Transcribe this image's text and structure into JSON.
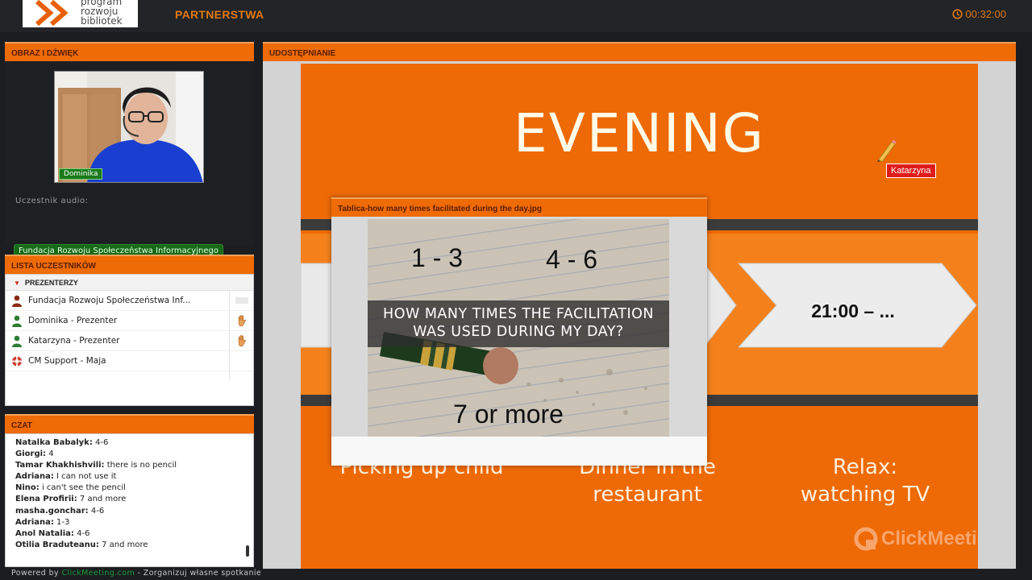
{
  "topbar": {
    "logo_lines": [
      "program",
      "rozwoju",
      "bibliotek"
    ],
    "meeting_title": "PARTNERSTWA",
    "timer": "00:32:00"
  },
  "video_panel": {
    "header": "OBRAZ I DŹWIĘK",
    "presenter_name": "Dominika",
    "audio_label": "Uczestnik audio:",
    "org_name": "Fundacja Rozwoju Społeczeństwa Informacyjnego"
  },
  "participants_panel": {
    "header": "LISTA UCZESTNIKÓW",
    "group": "PREZENTERZY",
    "items": [
      {
        "name": "Fundacja Rozwoju Społeczeństwa Inf...",
        "icon": "user-icon",
        "color": "#8b2a14"
      },
      {
        "name": "Dominika - Prezenter",
        "icon": "user-icon",
        "color": "#2e7d32"
      },
      {
        "name": "Katarzyna - Prezenter",
        "icon": "user-icon",
        "color": "#2e7d32"
      },
      {
        "name": "CM Support - Maja",
        "icon": "lifebuoy-icon",
        "color": "#d23a2a"
      }
    ]
  },
  "chat_panel": {
    "header": "CZAT",
    "messages": [
      {
        "author": "Natalka Babalyk:",
        "text": " 4-6"
      },
      {
        "author": "Giorgi:",
        "text": " 4"
      },
      {
        "author": "Tamar Khakhishvili:",
        "text": " there is no pencil"
      },
      {
        "author": "Adriana:",
        "text": " I can not use it"
      },
      {
        "author": "Nino:",
        "text": " i can't see the pencil"
      },
      {
        "author": "Elena Profirii:",
        "text": " 7 and more"
      },
      {
        "author": "masha.gonchar:",
        "text": " 4-6"
      },
      {
        "author": "Adriana:",
        "text": " 1-3"
      },
      {
        "author": "Anol Natalia:",
        "text": " 4-6"
      },
      {
        "author": "Otilia Braduteanu:",
        "text": " 7  and more"
      }
    ]
  },
  "footer": {
    "powered_prefix": "Powered by ",
    "powered_link": "ClickMeeting.com",
    "powered_suffix": " - Zorganizuj własne spotkanie"
  },
  "share_panel": {
    "header": "UDOSTĘPNIANIE",
    "slide": {
      "title": "EVENING",
      "arrow_text": "21:00 – ...",
      "activities": [
        [
          "Picking up child"
        ],
        [
          "Dinner in the",
          "restaurant"
        ],
        [
          "Relax:",
          "watching TV"
        ]
      ],
      "watermark": "ClickMeeting"
    },
    "cursor_label": "Katarzyna"
  },
  "image_window": {
    "title": "Tablica-how many times facilitated during the day.jpg",
    "label_a": "1 - 3",
    "label_b": "4 - 6",
    "label_c": "7 or more",
    "question_line1": "HOW MANY TIMES THE FACILITATION",
    "question_line2": "WAS USED DURING MY DAY?"
  },
  "colors": {
    "accent": "#ee6b06",
    "slide_bg": "#ee6a07",
    "band": "#3b3b3b",
    "online_green": "#176a17"
  }
}
